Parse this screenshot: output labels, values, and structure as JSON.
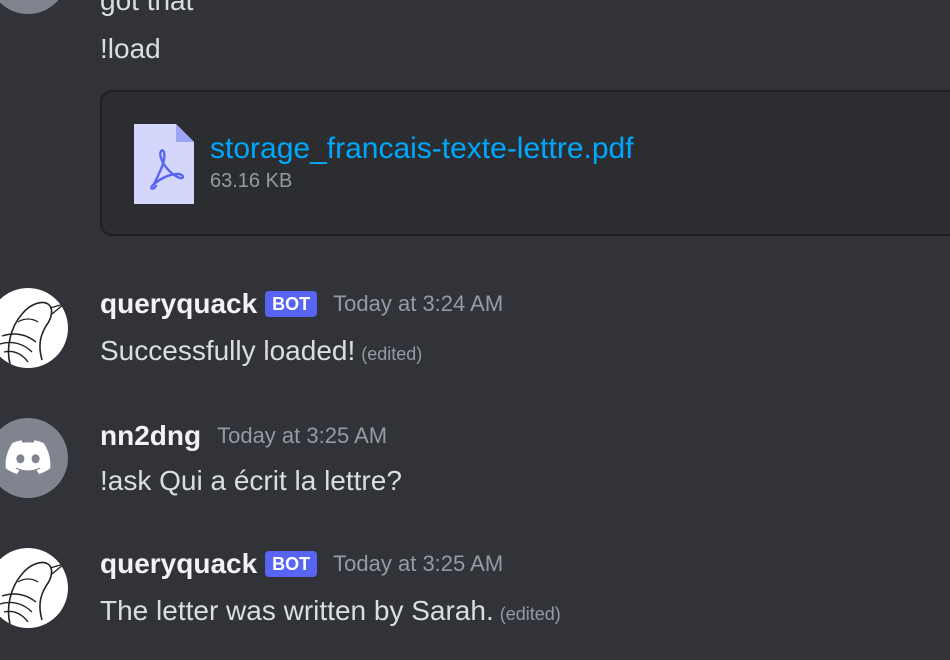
{
  "previous": {
    "partial_text": "got that",
    "load_command": "!load"
  },
  "attachment": {
    "filename": "storage_francais-texte-lettre.pdf",
    "size": "63.16 KB",
    "icon": "pdf-file-icon"
  },
  "messages": [
    {
      "username": "queryquack",
      "badge": "BOT",
      "timestamp": "Today at 3:24 AM",
      "text": "Successfully loaded!",
      "edited": "(edited)"
    },
    {
      "username": "nn2dng",
      "timestamp": "Today at 3:25 AM",
      "text": "!ask Qui a écrit la lettre?"
    },
    {
      "username": "queryquack",
      "badge": "BOT",
      "timestamp": "Today at 3:25 AM",
      "text": "The letter was written by Sarah.",
      "edited": "(edited)"
    }
  ],
  "colors": {
    "background": "#313338",
    "attachment_bg": "#2b2d31",
    "link": "#00a8fc",
    "bot_badge": "#5865f2",
    "muted": "#949ba4",
    "text": "#dbdee1"
  }
}
